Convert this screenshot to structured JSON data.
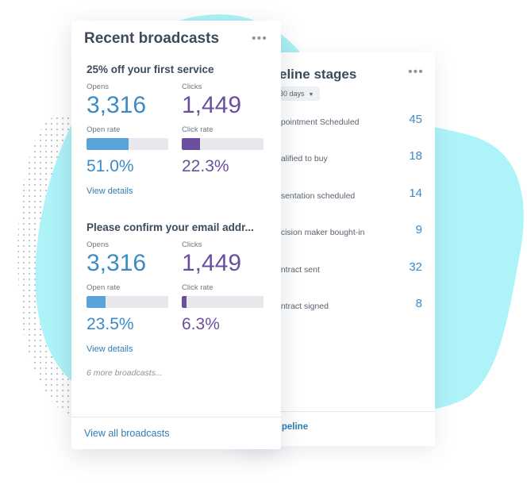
{
  "colors": {
    "accent_cyan": "#aef3f8",
    "link_blue": "#2f7db6",
    "opens_blue": "#3b8bc4",
    "clicks_purple": "#6a4f9e",
    "dots": "#b9c0c8"
  },
  "pipeline": {
    "title": "eline stages",
    "more_icon": "more-dots-icon",
    "more_glyph": "•••",
    "filter": "30 days",
    "stages": [
      {
        "label": "ppointment Scheduled",
        "count": "45"
      },
      {
        "label": "ualified to buy",
        "count": "18"
      },
      {
        "label": "esentation scheduled",
        "count": "14"
      },
      {
        "label": "ecision maker bought-in",
        "count": "9"
      },
      {
        "label": "ontract sent",
        "count": "32"
      },
      {
        "label": "ontract signed",
        "count": "8"
      }
    ],
    "footer_link": "Pipeline"
  },
  "broadcasts": {
    "title": "Recent broadcasts",
    "more_glyph": "•••",
    "items": [
      {
        "title": "25% off your first service",
        "opens_label": "Opens",
        "opens": "3,316",
        "clicks_label": "Clicks",
        "clicks": "1,449",
        "open_rate_label": "Open rate",
        "open_rate": "51.0%",
        "open_rate_value": 51.0,
        "click_rate_label": "Click rate",
        "click_rate": "22.3%",
        "click_rate_value": 22.3,
        "details_label": "View details"
      },
      {
        "title": "Please confirm your email addr...",
        "opens_label": "Opens",
        "opens": "3,316",
        "clicks_label": "Clicks",
        "clicks": "1,449",
        "open_rate_label": "Open rate",
        "open_rate": "23.5%",
        "open_rate_value": 23.5,
        "click_rate_label": "Click rate",
        "click_rate": "6.3%",
        "click_rate_value": 6.3,
        "details_label": "View details"
      }
    ],
    "more_text": "6 more broadcasts...",
    "view_all": "View all broadcasts"
  }
}
